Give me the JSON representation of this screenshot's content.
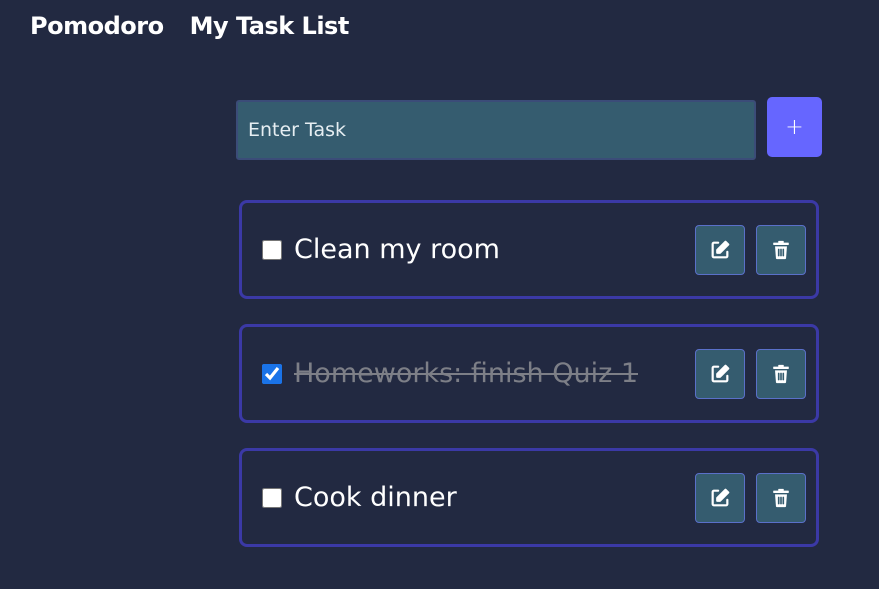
{
  "nav": {
    "pomodoro_label": "Pomodoro",
    "tasklist_label": "My Task List"
  },
  "input": {
    "placeholder": "Enter Task",
    "value": ""
  },
  "add_button": {
    "label": "+",
    "icon": "plus-icon"
  },
  "tasks": [
    {
      "text": "Clean my room",
      "completed": false
    },
    {
      "text": "Homeworks: finish Quiz 1",
      "completed": true
    },
    {
      "text": "Cook dinner",
      "completed": false
    }
  ],
  "task_actions": {
    "edit_icon": "edit-icon",
    "delete_icon": "trash-icon"
  },
  "colors": {
    "background": "#222941",
    "accent": "#6666ff",
    "input_bg": "#355c6f",
    "card_border": "#3b39a6",
    "completed_text": "#7d7f87",
    "checkbox_checked": "#1a73e8"
  }
}
